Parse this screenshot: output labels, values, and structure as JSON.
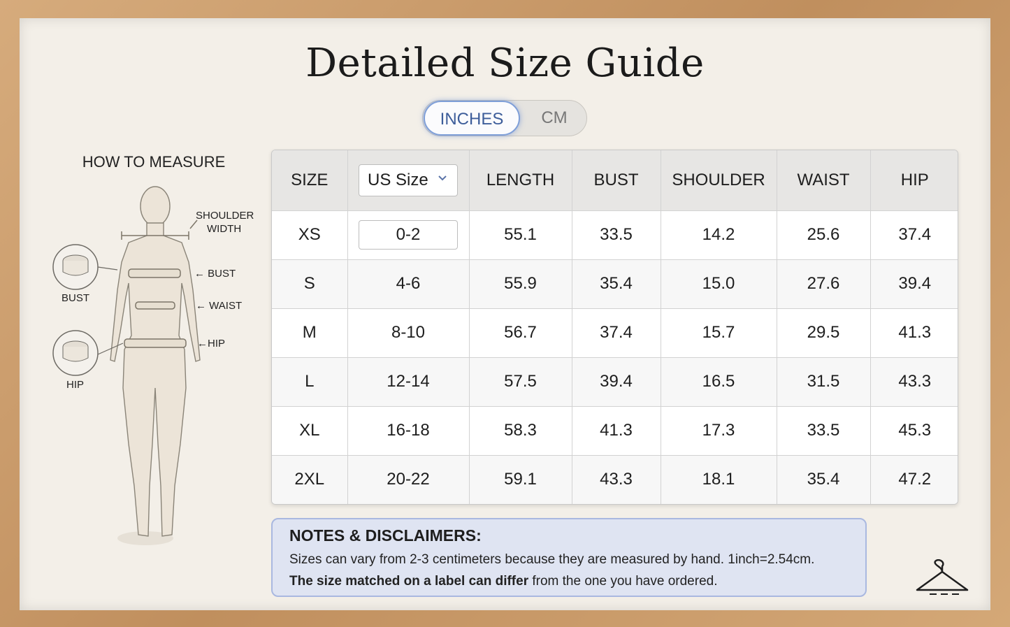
{
  "title": "Detailed Size Guide",
  "unit_toggle": {
    "options": [
      "INCHES",
      "CM"
    ],
    "selected": "INCHES"
  },
  "how_to_measure": {
    "heading": "HOW TO MEASURE",
    "labels": {
      "shoulder_line1": "SHOULDER",
      "shoulder_line2": "WIDTH",
      "bust": "← BUST",
      "waist": "← WAIST",
      "hip": "←HIP",
      "bust_tape": "BUST",
      "hip_tape": "HIP"
    }
  },
  "table": {
    "headers": {
      "size": "SIZE",
      "us_size": "US Size",
      "length": "LENGTH",
      "bust": "BUST",
      "shoulder": "SHOULDER",
      "waist": "WAIST",
      "hip": "HIP"
    },
    "rows": [
      {
        "size": "XS",
        "us": "0-2",
        "length": "55.1",
        "bust": "33.5",
        "shoulder": "14.2",
        "waist": "25.6",
        "hip": "37.4"
      },
      {
        "size": "S",
        "us": "4-6",
        "length": "55.9",
        "bust": "35.4",
        "shoulder": "15.0",
        "waist": "27.6",
        "hip": "39.4"
      },
      {
        "size": "M",
        "us": "8-10",
        "length": "56.7",
        "bust": "37.4",
        "shoulder": "15.7",
        "waist": "29.5",
        "hip": "41.3"
      },
      {
        "size": "L",
        "us": "12-14",
        "length": "57.5",
        "bust": "39.4",
        "shoulder": "16.5",
        "waist": "31.5",
        "hip": "43.3"
      },
      {
        "size": "XL",
        "us": "16-18",
        "length": "58.3",
        "bust": "41.3",
        "shoulder": "17.3",
        "waist": "33.5",
        "hip": "45.3"
      },
      {
        "size": "2XL",
        "us": "20-22",
        "length": "59.1",
        "bust": "43.3",
        "shoulder": "18.1",
        "waist": "35.4",
        "hip": "47.2"
      }
    ]
  },
  "notes": {
    "heading": "NOTES & DISCLAIMERS:",
    "line1": "Sizes can vary from 2-3 centimeters because they are measured by hand. 1inch=2.54cm.",
    "line2_bold": "The size matched on a label can differ",
    "line2_rest": " from the one you have ordered."
  },
  "icons": {
    "dropdown": "chevron-down-icon",
    "tape": "measuring-tape-icon",
    "hanger": "hanger-icon"
  },
  "colors": {
    "accent": "#3d5d9a",
    "notes_bg": "#dfe4f2",
    "frame": "#c99a6a"
  }
}
